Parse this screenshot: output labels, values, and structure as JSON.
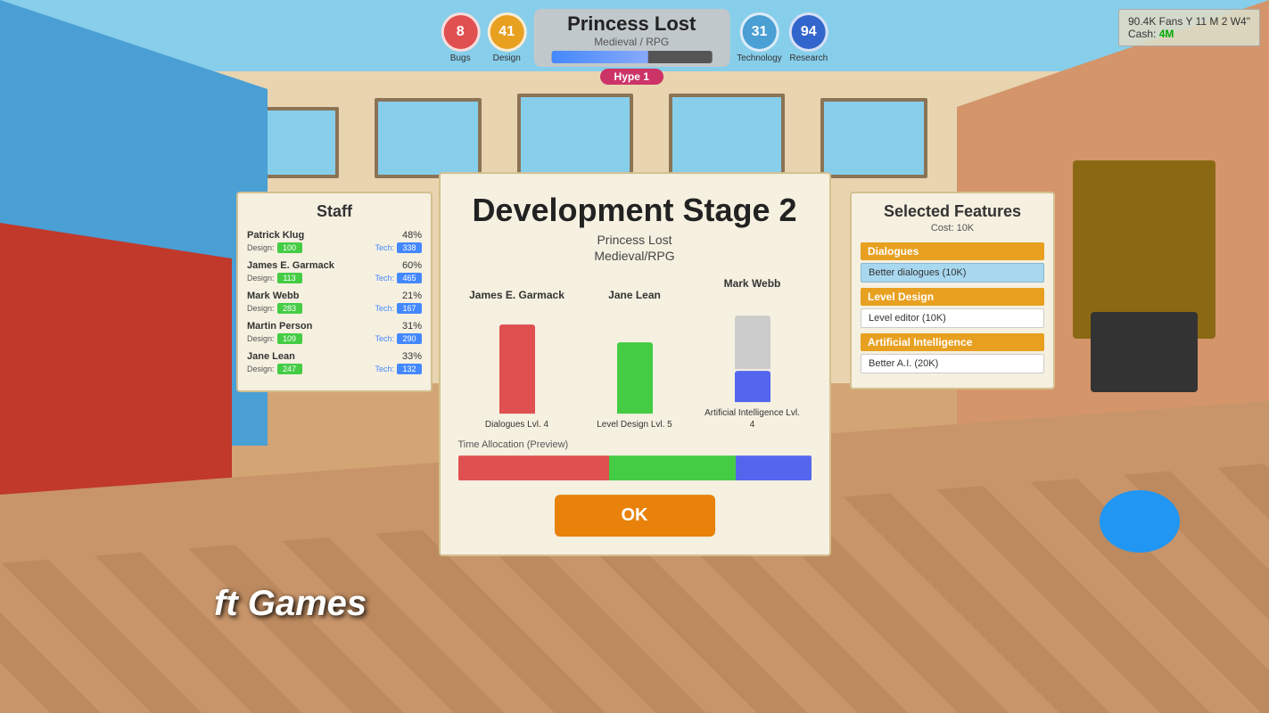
{
  "game": {
    "title": "Princess Lost",
    "genre": "Medieval / RPG",
    "hype": "Hype 1"
  },
  "hud": {
    "bug_count": "8",
    "design_score": "41",
    "technology_score": "31",
    "research_score": "94",
    "bubble_colors": {
      "bug": "#e05050",
      "design": "#e8a020",
      "tech": "#4488ff",
      "research": "#4488ff"
    },
    "labels": {
      "bug": "Bugs",
      "design": "Design",
      "tech": "Technology",
      "research": "Research"
    }
  },
  "stats": {
    "fans": "90.4K Fans",
    "year": "Y 11 M 2 W4\"",
    "cash_label": "Cash:",
    "cash_value": "4M"
  },
  "staff_panel": {
    "title": "Staff",
    "members": [
      {
        "name": "Patrick Klug",
        "pct": "48%",
        "design": "100",
        "tech": "338"
      },
      {
        "name": "James E. Garmack",
        "pct": "60%",
        "design": "113",
        "tech": "465"
      },
      {
        "name": "Mark Webb",
        "pct": "21%",
        "design": "283",
        "tech": "167"
      },
      {
        "name": "Martin Person",
        "pct": "31%",
        "design": "109",
        "tech": "290"
      },
      {
        "name": "Jane Lean",
        "pct": "33%",
        "design": "247",
        "tech": "132"
      }
    ]
  },
  "dev_stage": {
    "title": "Development Stage 2",
    "game_name": "Princess Lost",
    "genre": "Medieval/RPG",
    "staff_columns": [
      {
        "name": "James E. Garmack",
        "bar_color": "red",
        "label": "Dialogues Lvl. 4"
      },
      {
        "name": "Jane Lean",
        "bar_color": "green",
        "label": "Level Design Lvl. 5"
      },
      {
        "name": "Mark Webb",
        "bar_color": "blue",
        "label": "Artificial Intelligence Lvl. 4"
      }
    ],
    "time_allocation_label": "Time Allocation (Preview)",
    "ok_label": "OK"
  },
  "features": {
    "title": "Selected Features",
    "cost": "Cost: 10K",
    "categories": [
      {
        "name": "Dialogues",
        "items": [
          {
            "label": "Better dialogues (10K)",
            "selected": true
          }
        ]
      },
      {
        "name": "Level Design",
        "items": [
          {
            "label": "Level editor (10K)",
            "selected": false
          }
        ]
      },
      {
        "name": "Artificial Intelligence",
        "items": [
          {
            "label": "Better A.I. (20K)",
            "selected": false
          }
        ]
      }
    ]
  }
}
